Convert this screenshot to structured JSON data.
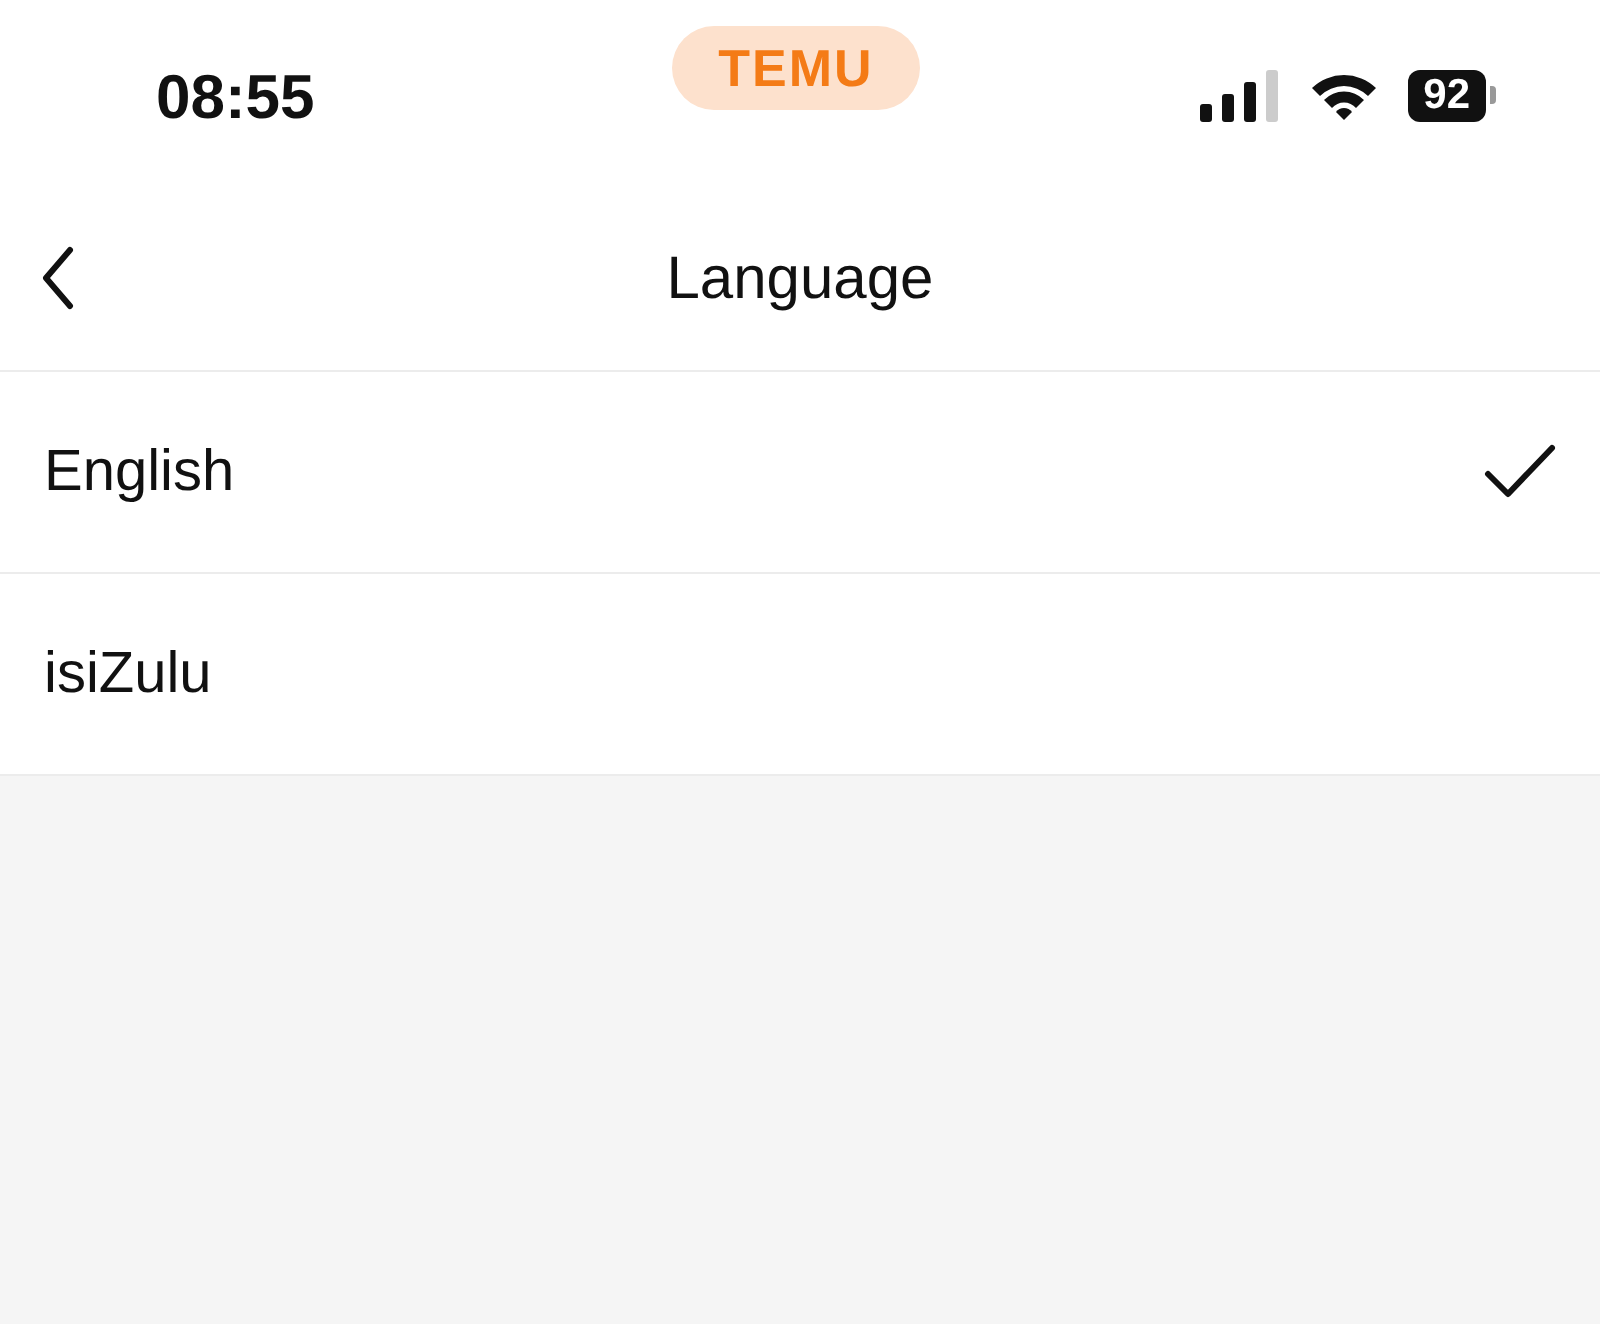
{
  "status_bar": {
    "time": "08:55",
    "app_badge": "TEMU",
    "battery": "92"
  },
  "nav": {
    "title": "Language"
  },
  "languages": [
    {
      "label": "English",
      "selected": true
    },
    {
      "label": "isiZulu",
      "selected": false
    }
  ]
}
